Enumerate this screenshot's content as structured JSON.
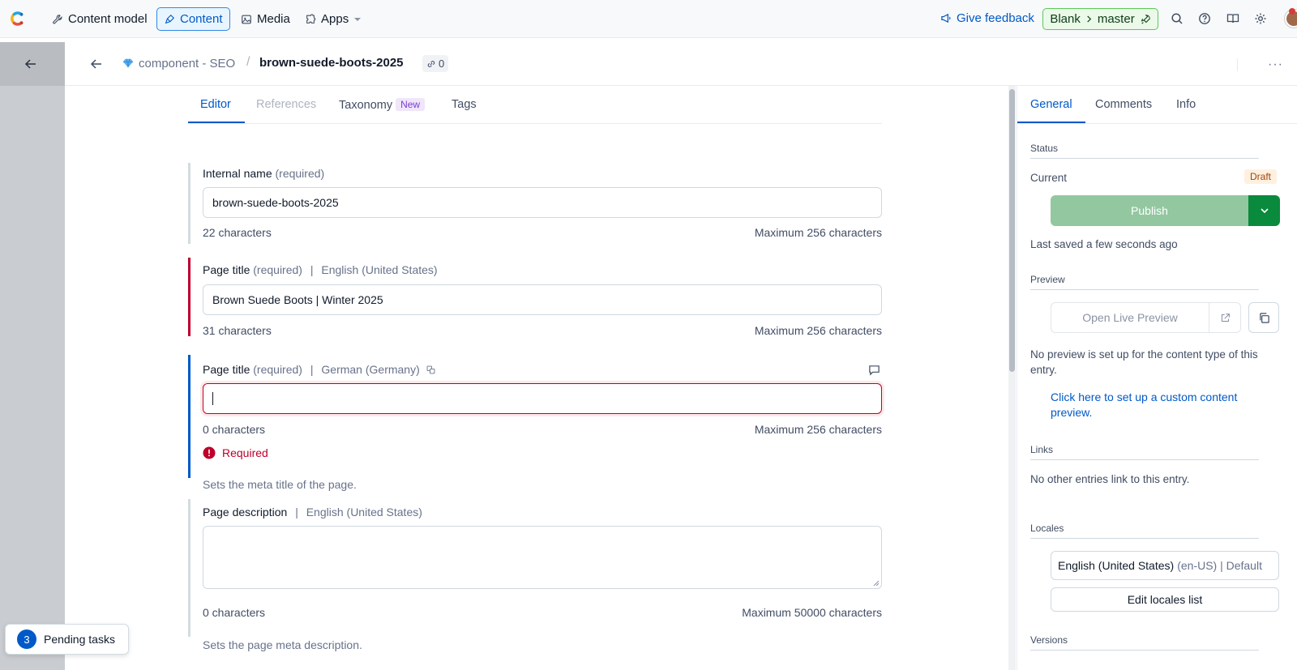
{
  "nav": {
    "items": [
      {
        "label": "Content model",
        "icon": "wrench-icon"
      },
      {
        "label": "Content",
        "icon": "pen-nib-icon"
      },
      {
        "label": "Media",
        "icon": "image-icon"
      },
      {
        "label": "Apps",
        "icon": "puzzle-icon"
      }
    ],
    "feedback": "Give feedback",
    "environment": {
      "space": "Blank",
      "env": "master"
    }
  },
  "entry": {
    "content_type": "component - SEO",
    "title": "brown-suede-boots-2025",
    "references_count": "0"
  },
  "editor": {
    "tabs": [
      "Editor",
      "References",
      "Taxonomy",
      "Tags"
    ],
    "taxonomy_badge": "New",
    "fields": [
      {
        "label": "Internal name",
        "required": "(required)",
        "locale": "",
        "value": "brown-suede-boots-2025",
        "count": "22 characters",
        "max": "Maximum 256 characters",
        "help": "",
        "error": ""
      },
      {
        "label": "Page title",
        "required": "(required)",
        "locale": "English (United States)",
        "value": "Brown Suede Boots | Winter 2025",
        "count": "31 characters",
        "max": "Maximum 256 characters",
        "help": "",
        "error": ""
      },
      {
        "label": "Page title",
        "required": "(required)",
        "locale": "German (Germany)",
        "value": "",
        "count": "0 characters",
        "max": "Maximum 256 characters",
        "help": "Sets the meta title of the page.",
        "error": "Required"
      },
      {
        "label": "Page description",
        "required": "",
        "locale": "English (United States)",
        "value": "",
        "count": "0 characters",
        "max": "Maximum 50000 characters",
        "help": "Sets the page meta description.",
        "error": ""
      }
    ]
  },
  "sidebar": {
    "tabs": [
      "General",
      "Comments",
      "Info"
    ],
    "status": {
      "heading": "Status",
      "current_label": "Current",
      "badge": "Draft",
      "publish_label": "Publish",
      "last_saved": "Last saved a few seconds ago"
    },
    "preview": {
      "heading": "Preview",
      "button_label": "Open Live Preview",
      "note": "No preview is set up for the content type of this entry.",
      "link": "Click here to set up a custom content preview."
    },
    "links": {
      "heading": "Links",
      "text": "No other entries link to this entry."
    },
    "locales": {
      "heading": "Locales",
      "locale": "English (United States)",
      "locale_meta": "(en-US) | Default",
      "edit_label": "Edit locales list"
    },
    "versions": {
      "heading": "Versions"
    }
  },
  "pending": {
    "count": "3",
    "label": "Pending tasks"
  },
  "colors": {
    "accent": "#0059c8",
    "error": "#bd002a",
    "publish": "#93c7a0",
    "publish_dark": "#0a8a3c",
    "environment_green": "#5ec85a"
  }
}
